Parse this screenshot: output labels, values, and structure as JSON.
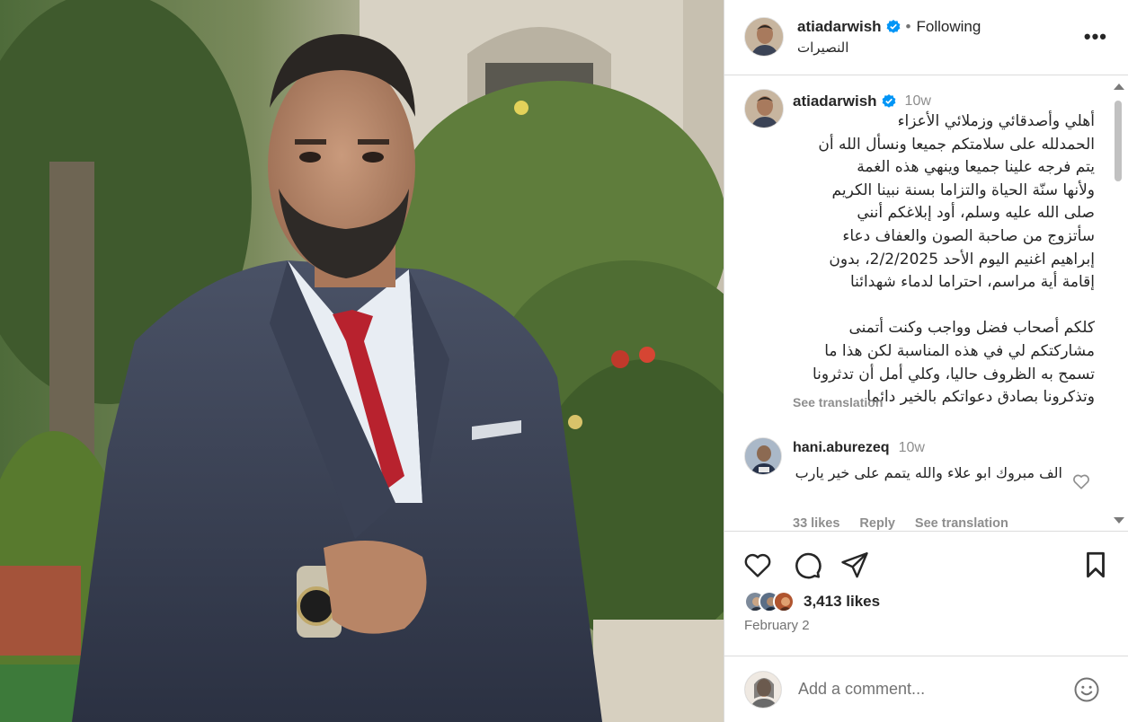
{
  "post": {
    "username": "atiadarwish",
    "follow_status": "Following",
    "separator": "•",
    "location": "النصيرات",
    "more_label": "•••"
  },
  "caption": {
    "username": "atiadarwish",
    "time": "10w",
    "text": "أهلي وأصدقائي وزملائي الأعزاء\nالحمدلله على سلامتكم جميعا ونسأل الله أن\nيتم فرجه علينا جميعا وينهي هذه الغمة\nولأنها سنّة الحياة والتزاما بسنة نبينا الكريم\nصلى الله عليه وسلم، أود إبلاغكم أنني\nسأتزوج من صاحبة الصون والعفاف دعاء\nإبراهيم اغنيم اليوم الأحد 2/2/2025، بدون\nإقامة أية مراسم، احتراما لدماء شهدائنا\n\nكلكم أصحاب فضل وواجب وكنت أتمنى\nمشاركتكم لي في هذه المناسبة لكن هذا ما\nتسمح به الظروف حاليا، وكلي أمل أن تدثرونا\nوتذكرونا بصادق دعواتكم بالخير دائما",
    "see_translation": "See translation"
  },
  "comment": {
    "username": "hani.aburezeq",
    "time": "10w",
    "text": "الف مبروك ابو علاء والله يتمم على خير يارب",
    "likes": "33 likes",
    "reply": "Reply",
    "see_translation": "See translation"
  },
  "stats": {
    "likes": "3,413 likes",
    "date": "February 2"
  },
  "add_comment": {
    "placeholder": "Add a comment..."
  },
  "icons": {
    "verified": "verified-badge-icon",
    "like": "heart-icon",
    "comment": "comment-bubble-icon",
    "share": "paper-plane-icon",
    "save": "bookmark-icon",
    "emoji": "smiley-icon"
  },
  "colors": {
    "verified_blue": "#0095f6",
    "text": "#262626",
    "muted": "#8e8e8e",
    "border": "#dbdbdb"
  }
}
